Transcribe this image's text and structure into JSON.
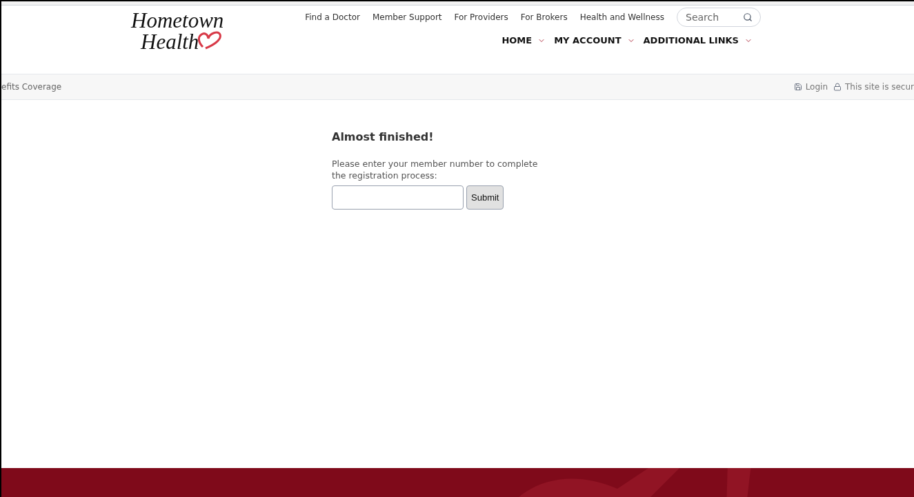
{
  "logo": {
    "line_1": "Hometown",
    "line_2": "Health"
  },
  "top_links": [
    "Find a Doctor",
    "Member Support",
    "For Providers",
    "For Brokers",
    "Health and Wellness"
  ],
  "search": {
    "placeholder": "Search"
  },
  "main_nav": [
    "HOME",
    "MY ACCOUNT",
    "ADDITIONAL LINKS"
  ],
  "breadcrumb": "efits Coverage",
  "utility_links": [
    {
      "kind": "login",
      "label": "Login"
    },
    {
      "kind": "secure",
      "label": "This site is secur"
    }
  ],
  "form": {
    "heading": "Almost finished!",
    "instructions": "Please enter your member number to complete the registration process:",
    "button": "Submit"
  }
}
